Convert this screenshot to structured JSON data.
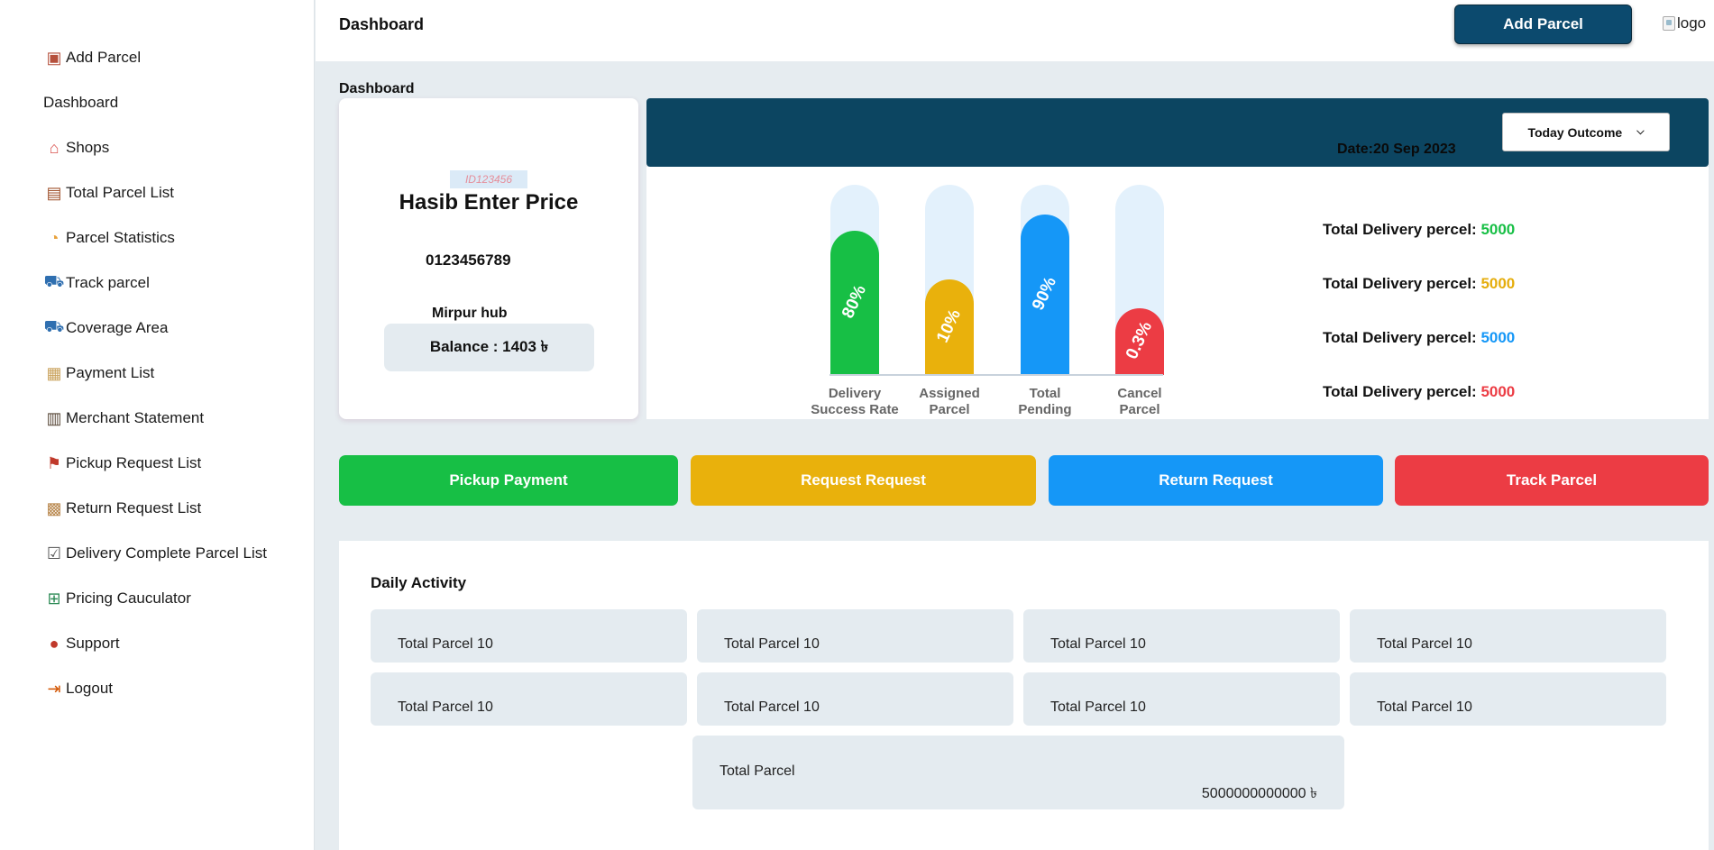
{
  "sidebar": {
    "items": [
      {
        "label": "Add Parcel",
        "icon": "parcel-add-icon"
      },
      {
        "label": "Dashboard",
        "icon": ""
      },
      {
        "label": "Shops",
        "icon": "shop-icon"
      },
      {
        "label": "Total Parcel List",
        "icon": "clipboard-icon"
      },
      {
        "label": "Parcel Statistics",
        "icon": "statistics-icon"
      },
      {
        "label": "Track parcel",
        "icon": "delivery-truck-icon"
      },
      {
        "label": "Coverage Area",
        "icon": "coverage-truck-icon"
      },
      {
        "label": "Payment List",
        "icon": "payment-list-icon"
      },
      {
        "label": "Merchant Statement",
        "icon": "statement-icon"
      },
      {
        "label": "Pickup Request List",
        "icon": "pickup-scooter-icon"
      },
      {
        "label": "Return Request List",
        "icon": "return-box-icon"
      },
      {
        "label": "Delivery Complete Parcel List",
        "icon": "checklist-icon"
      },
      {
        "label": "Pricing Cauculator",
        "icon": "calculator-icon"
      },
      {
        "label": "Support",
        "icon": "support-icon"
      },
      {
        "label": "Logout",
        "icon": "logout-icon"
      }
    ]
  },
  "header": {
    "title": "Dashboard",
    "add_parcel_label": "Add Parcel",
    "logo_alt": "logo"
  },
  "main": {
    "section_label": "Dashboard",
    "profile": {
      "id": "ID123456",
      "name": "Hasib Enter Price",
      "phone": "0123456789",
      "hub": "Mirpur hub",
      "balance": "Balance : 1403 ৳"
    },
    "outcome": {
      "date": "Date:20 Sep 2023",
      "select_value": "Today Outcome"
    },
    "stats": [
      {
        "label": "Total Delivery percel:",
        "value": "5000",
        "color": "#17bf45"
      },
      {
        "label": "Total Delivery percel:",
        "value": "5000",
        "color": "#e5ad0c"
      },
      {
        "label": "Total Delivery percel:",
        "value": "5000",
        "color": "#1597f7"
      },
      {
        "label": "Total Delivery percel:",
        "value": "5000",
        "color": "#ec3c44"
      }
    ],
    "actions": [
      {
        "label": "Pickup Payment",
        "color": "#17bf45"
      },
      {
        "label": "Request Request",
        "color": "#e9b10c"
      },
      {
        "label": "Return Request",
        "color": "#1597f7"
      },
      {
        "label": "Track Parcel",
        "color": "#ec3c44"
      }
    ],
    "daily": {
      "title": "Daily Activity",
      "tiles": [
        "Total Parcel 10",
        "Total Parcel 10",
        "Total Parcel 10",
        "Total Parcel 10",
        "Total Parcel 10",
        "Total Parcel 10",
        "Total Parcel 10",
        "Total Parcel 10"
      ],
      "total": {
        "label": "Total Parcel",
        "value": "5000000000000 ৳"
      }
    }
  },
  "chart_data": {
    "type": "bar",
    "categories": [
      "Delivery Success Rate",
      "Assigned Parcel",
      "Total Pending",
      "Cancel Parcel"
    ],
    "label_lines": [
      [
        "Delivery",
        "Success Rate"
      ],
      [
        "Assigned",
        "Parcel"
      ],
      [
        "Total",
        "Pending"
      ],
      [
        "Cancel",
        "Parcel"
      ]
    ],
    "values": [
      80,
      10,
      90,
      0.3
    ],
    "value_labels": [
      "80%",
      "10%",
      "90%",
      "0.3%"
    ],
    "colors": [
      "#17bf45",
      "#e9b10c",
      "#1597f7",
      "#ec3c44"
    ],
    "ylim": [
      0,
      100
    ]
  }
}
